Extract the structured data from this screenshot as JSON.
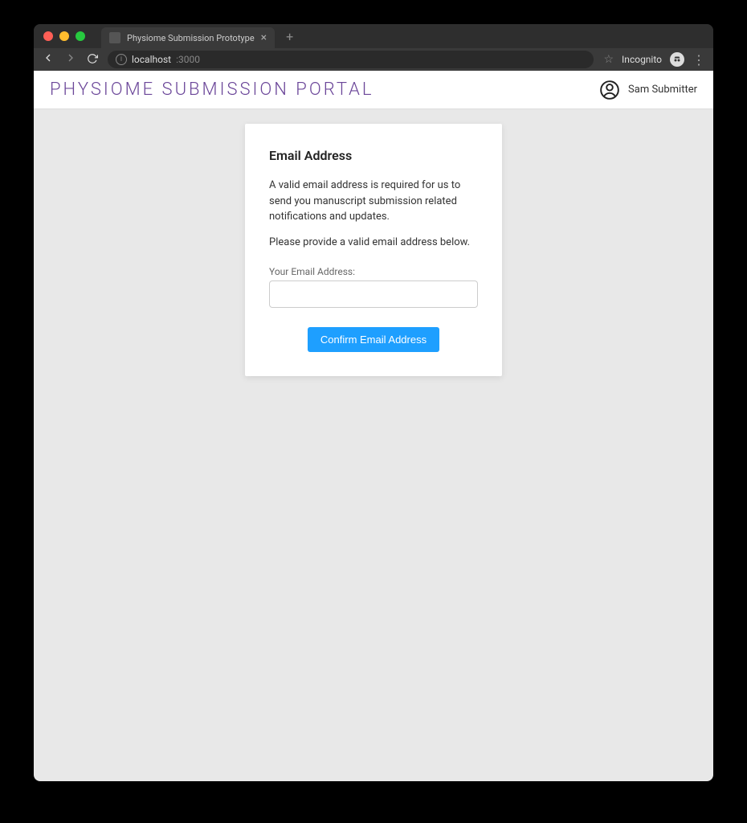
{
  "browser": {
    "tab_title": "Physiome Submission Prototype",
    "url_host": "localhost",
    "url_port": ":3000",
    "incognito_label": "Incognito"
  },
  "header": {
    "site_title": "PHYSIOME SUBMISSION PORTAL",
    "user_name": "Sam Submitter"
  },
  "card": {
    "title": "Email Address",
    "paragraph1": "A valid email address is required for us to send you manuscript submission related notifications and updates.",
    "paragraph2": "Please provide a valid email address below.",
    "field_label": "Your Email Address:",
    "input_value": "",
    "button_label": "Confirm Email Address"
  }
}
